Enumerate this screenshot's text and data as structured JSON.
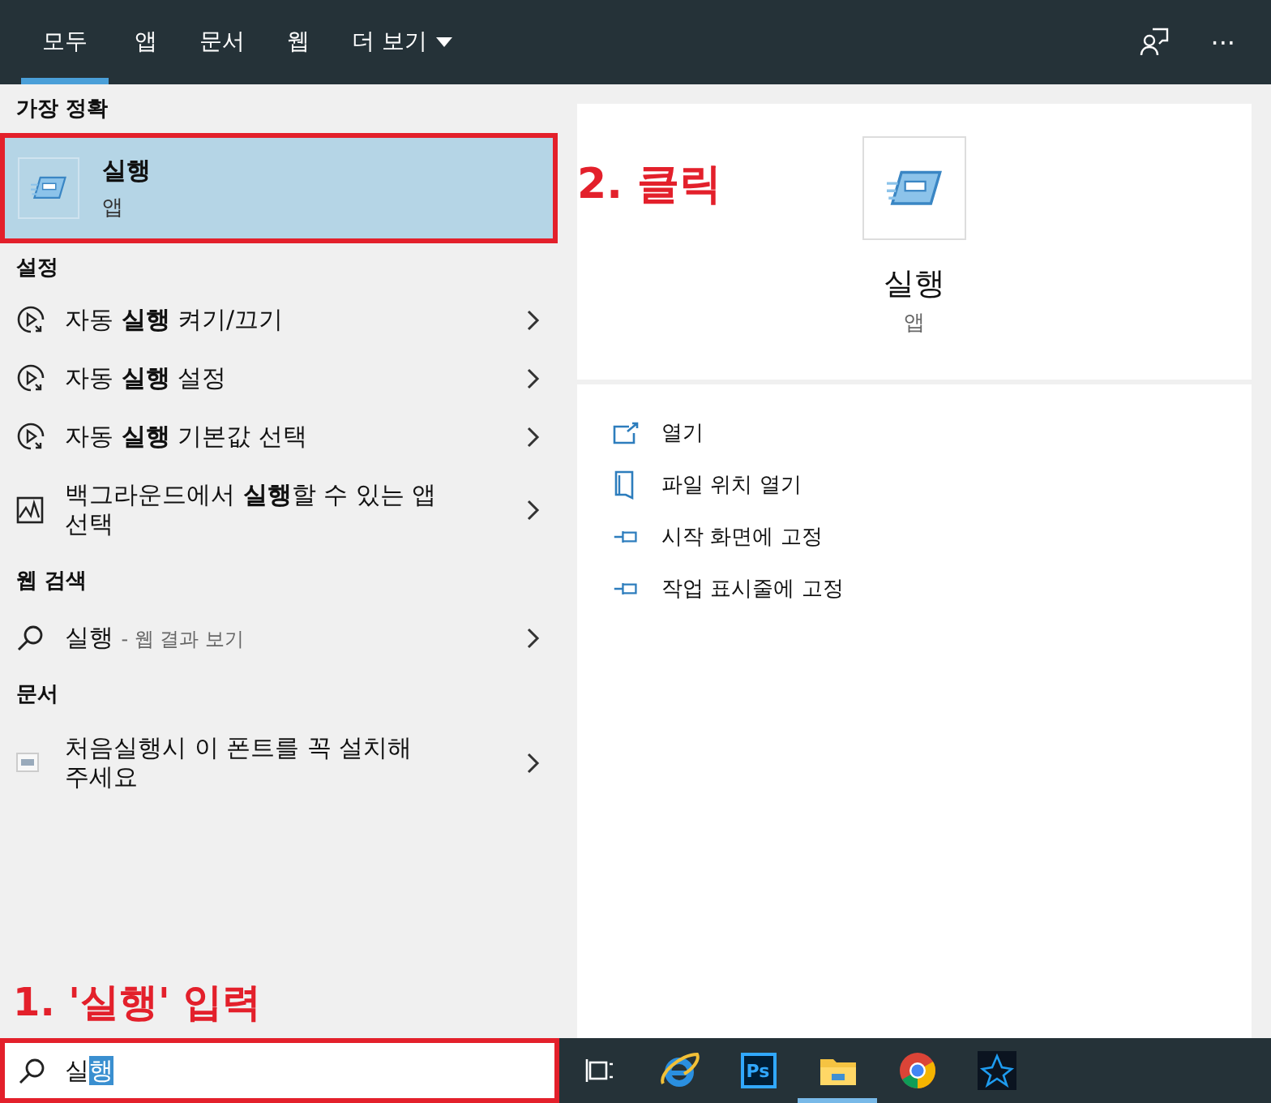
{
  "tabs": [
    {
      "label": "모두",
      "selected": true,
      "kind": "tab"
    },
    {
      "label": "앱",
      "selected": false,
      "kind": "tab"
    },
    {
      "label": "문서",
      "selected": false,
      "kind": "tab"
    },
    {
      "label": "웹",
      "selected": false,
      "kind": "tab"
    },
    {
      "label": "더 보기",
      "selected": false,
      "kind": "menu"
    }
  ],
  "more_button": "···",
  "best_match": {
    "header": "가장 정확",
    "title": "실행",
    "subtitle": "앱",
    "selected": true,
    "outlined": true
  },
  "sections": [
    {
      "header": "설정",
      "items": [
        {
          "kind": "autoplay",
          "label": "자동 **실행** 켜기/끄기"
        },
        {
          "kind": "autoplay",
          "label": "자동 **실행** 설정"
        },
        {
          "kind": "autoplay",
          "label": "자동 **실행** 기본값 선택"
        },
        {
          "kind": "background",
          "label": "백그라운드에서 **실행**할 수 있는 앱 선택"
        }
      ]
    },
    {
      "header": "웹 검색",
      "items": [
        {
          "kind": "web",
          "label": "실행",
          "suffix": "- 웹 결과 보기"
        }
      ]
    },
    {
      "header": "문서",
      "items": [
        {
          "kind": "document",
          "label": "처음실행시 이 폰트를 꼭 설치해 주세요"
        }
      ]
    }
  ],
  "click_note": "2. 클릭",
  "input_note": "1. '실행' 입력",
  "preview": {
    "title": "실행",
    "subtitle": "앱",
    "actions": [
      {
        "kind": "open",
        "label": "열기"
      },
      {
        "kind": "folder",
        "label": "파일 위치 열기"
      },
      {
        "kind": "pin",
        "label": "시작 화면에 고정"
      },
      {
        "kind": "pin",
        "label": "작업 표시줄에 고정"
      }
    ]
  },
  "search": {
    "outlined": true,
    "parts": [
      {
        "text": "실",
        "selected": false
      },
      {
        "text": "행",
        "selected": true
      }
    ]
  },
  "taskbar": [
    {
      "kind": "task-view",
      "active": false
    },
    {
      "kind": "browser",
      "active": false
    },
    {
      "kind": "photo-editor",
      "label": "Ps",
      "active": false
    },
    {
      "kind": "folder",
      "active": true
    },
    {
      "kind": "chrome",
      "active": false
    },
    {
      "kind": "star-app",
      "active": false
    }
  ]
}
